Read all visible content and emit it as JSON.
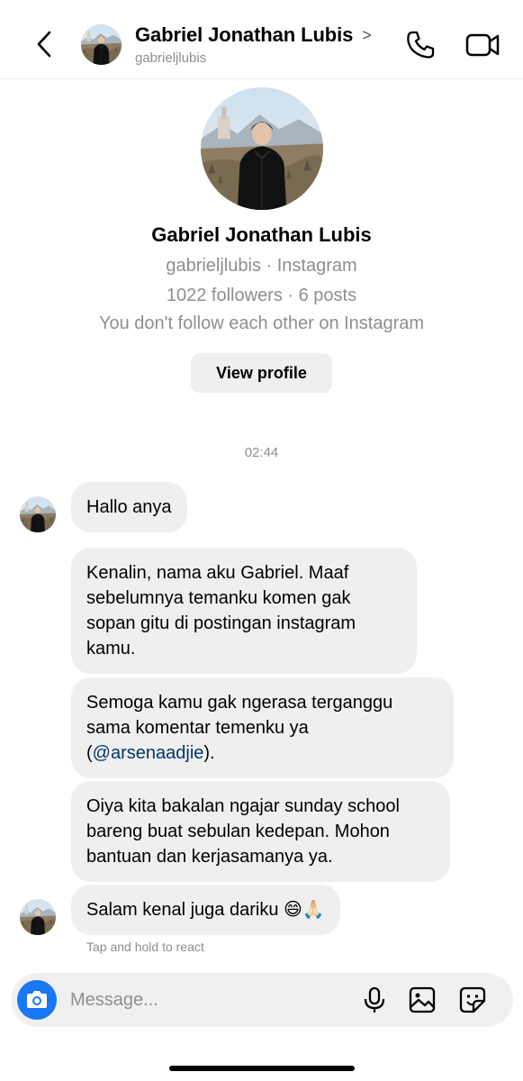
{
  "header": {
    "name": "Gabriel Jonathan Lubis",
    "chevron": ">",
    "username": "gabrieljlubis"
  },
  "profile": {
    "name": "Gabriel Jonathan Lubis",
    "username_line": "gabrieljlubis · Instagram",
    "stats_line": "1022 followers · 6 posts",
    "relation_line": "You don't follow each other on Instagram",
    "view_profile_label": "View profile"
  },
  "timestamp": "02:44",
  "messages": [
    {
      "text": "Hallo anya"
    },
    {
      "text": "Kenalin, nama aku Gabriel. Maaf sebelumnya temanku komen gak sopan gitu di postingan instagram kamu."
    },
    {
      "text_before": "Semoga kamu gak ngerasa terganggu sama komentar temenku ya (",
      "mention": "@arsenaadjie",
      "text_after": ")."
    },
    {
      "text": "Oiya kita bakalan ngajar sunday school bareng buat sebulan kedepan. Mohon bantuan dan kerjasamanya ya."
    },
    {
      "text": "Salam kenal juga dariku 😄🙏🏻"
    }
  ],
  "react_hint": "Tap and hold to react",
  "composer": {
    "placeholder": "Message..."
  },
  "colors": {
    "accent_blue": "#1877f2",
    "mention": "#00376b",
    "bubble": "#efefef",
    "secondary_text": "#8e8e8e"
  },
  "icons": [
    "back-arrow-icon",
    "chevron-right-icon",
    "phone-icon",
    "video-camera-icon",
    "camera-icon",
    "microphone-icon",
    "image-icon",
    "sticker-icon"
  ]
}
